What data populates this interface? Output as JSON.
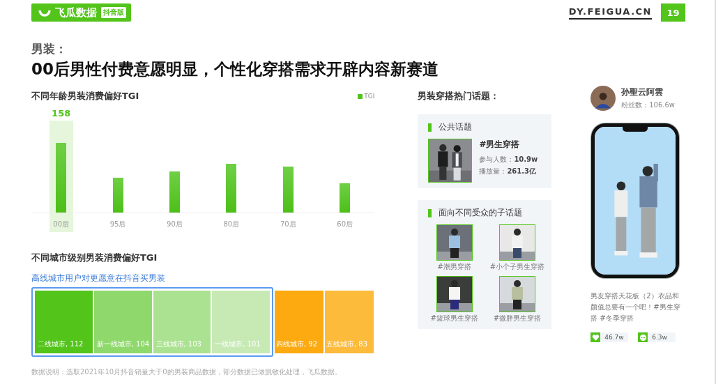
{
  "header": {
    "logo_text": "飞瓜数据",
    "logo_badge": "抖音版",
    "site": "DY.FEIGUA.CN",
    "page_number": "19"
  },
  "heading": {
    "kicker": "男装：",
    "title": "00后男性付费意愿明显，个性化穿搭需求开辟内容新赛道"
  },
  "age_chart": {
    "title": "不同年龄男装消费偏好TGI",
    "legend": "TGI",
    "value_label": "158",
    "categories": [
      {
        "label": "00后",
        "selected": true
      },
      {
        "label": "95后",
        "selected": false
      },
      {
        "label": "90后",
        "selected": false
      },
      {
        "label": "80后",
        "selected": false
      },
      {
        "label": "70后",
        "selected": false
      },
      {
        "label": "60后",
        "selected": false
      }
    ]
  },
  "city_chart": {
    "title": "不同城市级别男装消费偏好TGI",
    "highlight_caption": "高线城市用户对更愿意在抖音买男装",
    "cells": [
      {
        "label": "二线城市, 112",
        "color": "#52c41a",
        "highlighted": true
      },
      {
        "label": "新一线城市, 104",
        "color": "#8fd86c",
        "highlighted": true
      },
      {
        "label": "三线城市, 103",
        "color": "#abe291",
        "highlighted": true
      },
      {
        "label": "一线城市, 101",
        "color": "#c7eab5",
        "highlighted": true
      },
      {
        "label": "四线城市, 92",
        "color": "#fcaa10",
        "highlighted": false
      },
      {
        "label": "五线城市, 83",
        "color": "#fdbb3c",
        "highlighted": false
      }
    ]
  },
  "footnote": "数据说明：选取2021年10月抖音销量大于0的男装商品数据，部分数据已做脱敏化处理，飞瓜数据。",
  "topics": {
    "title": "男装穿搭热门话题：",
    "public": {
      "section": "公共话题",
      "tag": "#男生穿搭",
      "participants_label": "参与人数：",
      "participants": "10.9w",
      "plays_label": "播放量：",
      "plays": "261.3亿"
    },
    "sub": {
      "section": "面向不同受众的子话题",
      "items": [
        {
          "tag": "#潮男穿搭"
        },
        {
          "tag": "#小个子男生穿搭"
        },
        {
          "tag": "#篮球男生穿搭"
        },
        {
          "tag": "#微胖男生穿搭"
        }
      ]
    }
  },
  "creator": {
    "name": "孙聖云阿雲",
    "fans": "粉丝数：106.6w",
    "caption": "男友穿搭天花板（2）衣品和颜值总要有一个吧！#男生穿搭 #冬季穿搭",
    "likes": "46.7w",
    "comments": "6.3w"
  }
}
